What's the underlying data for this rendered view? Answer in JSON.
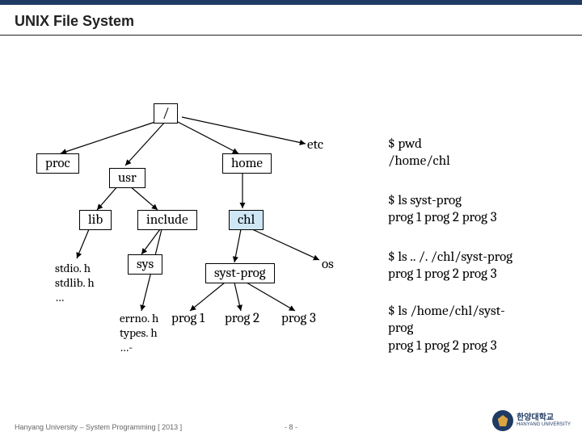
{
  "title": "UNIX File System",
  "tree": {
    "root": "/",
    "proc": "proc",
    "usr": "usr",
    "home": "home",
    "etc": "etc",
    "lib": "lib",
    "include": "include",
    "chl": "chl",
    "stdio_list": "stdio. h\nstdlib. h\n…",
    "sys": "sys",
    "syst_prog": "syst-prog",
    "os": "os",
    "errno_list": "errno. h\ntypes. h\n…-",
    "prog1": "prog 1",
    "prog2": "prog 2",
    "prog3": "prog 3"
  },
  "commands": {
    "c1": "$ pwd\n/home/chl",
    "c2": "$ ls syst-prog\nprog 1 prog 2 prog 3",
    "c3": "$ ls .. /. /chl/syst-prog\nprog 1 prog 2 prog 3",
    "c4": "$ ls /home/chl/syst-\nprog\nprog 1 prog 2 prog 3"
  },
  "footer": "Hanyang University – System Programming  [ 2013 ]",
  "page": "- 8 -",
  "logo_text": "한양대학교",
  "logo_sub": "HANYANG UNIVERSITY"
}
